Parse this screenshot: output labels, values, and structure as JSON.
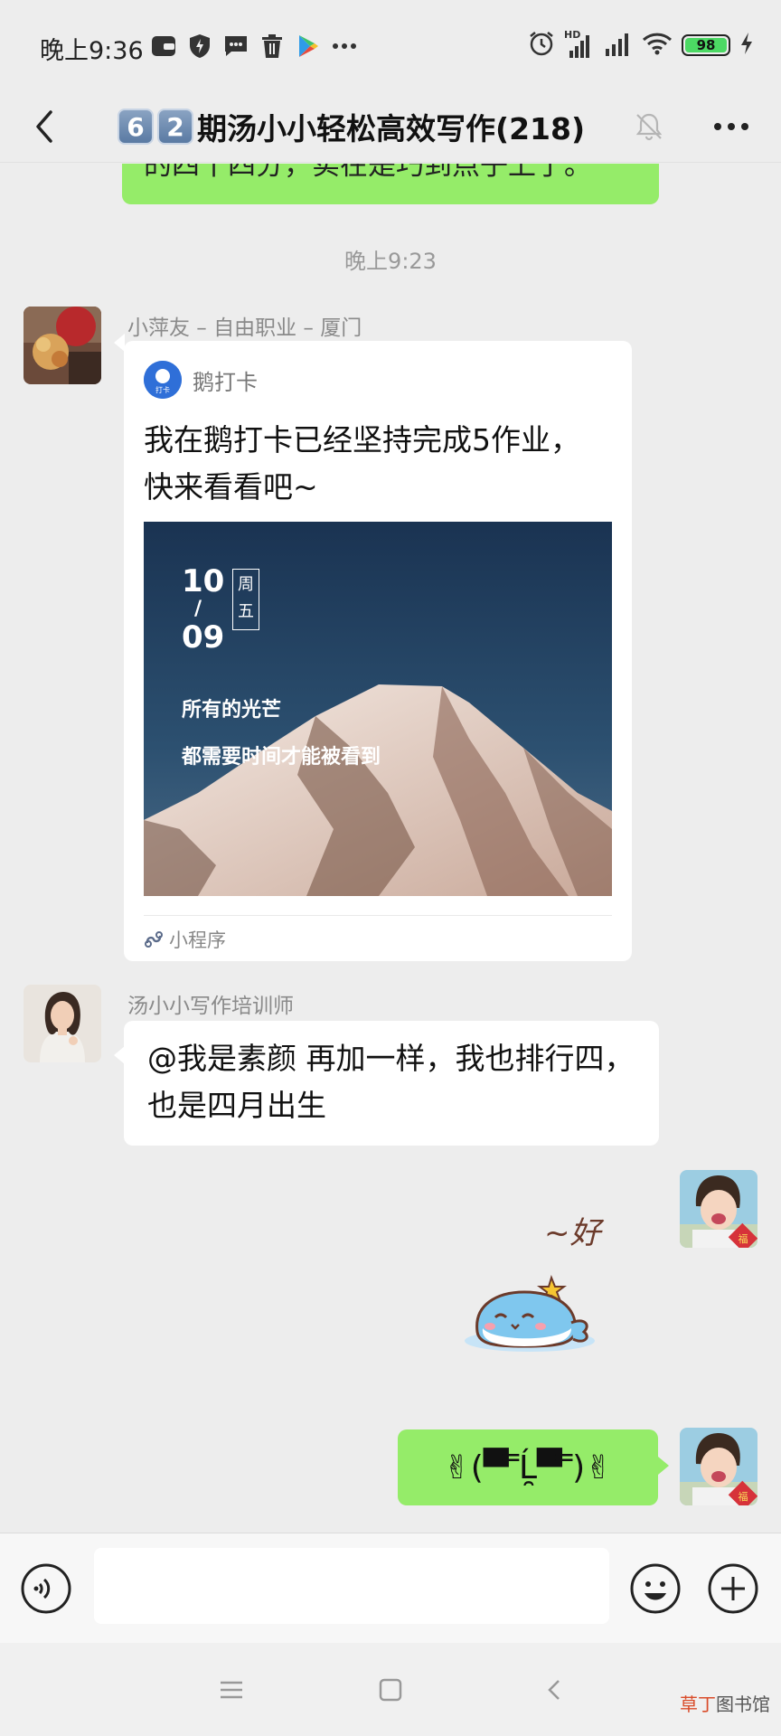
{
  "status_bar": {
    "time": "晚上9:36",
    "network_label": "HD",
    "battery_level": "98",
    "icons": [
      "wallet-icon",
      "shield-icon",
      "message-icon",
      "trash-icon",
      "play-store-icon",
      "more-dots-icon",
      "alarm-icon",
      "signal-icon",
      "signal-icon",
      "wifi-icon",
      "battery-icon",
      "charging-icon"
    ]
  },
  "header": {
    "badge_1": "6",
    "badge_2": "2",
    "title": "期汤小小轻松高效写作(218)",
    "muted": true
  },
  "chat": {
    "cut_message": "的四十四分，实在是巧到点子上了。",
    "timestamp": "晚上9:23",
    "card_message": {
      "sender": "小萍友 – 自由职业 – 厦门",
      "app_name": "鹅打卡",
      "logo_text": "打卡",
      "text": "我在鹅打卡已经坚持完成5作业，快来看看吧~",
      "image": {
        "month": "10",
        "slash": "/",
        "day": "09",
        "weekday": "周五",
        "line1": "所有的光芒",
        "line2": "都需要时间才能被看到"
      },
      "footer": "小程序"
    },
    "text_message": {
      "sender": "汤小小写作培训师",
      "text": "@我是素颜  再加一样，我也排行四，也是四月出生"
    },
    "sticker_text": "~好",
    "kaomoji": "✌(▀ ̿Ĺ̯▀ ̿)✌"
  },
  "input": {
    "placeholder": ""
  },
  "watermark": {
    "part1": "草丁",
    "part2": "图书馆"
  },
  "colors": {
    "bubble_green": "#95ec69",
    "background": "#ededed"
  }
}
